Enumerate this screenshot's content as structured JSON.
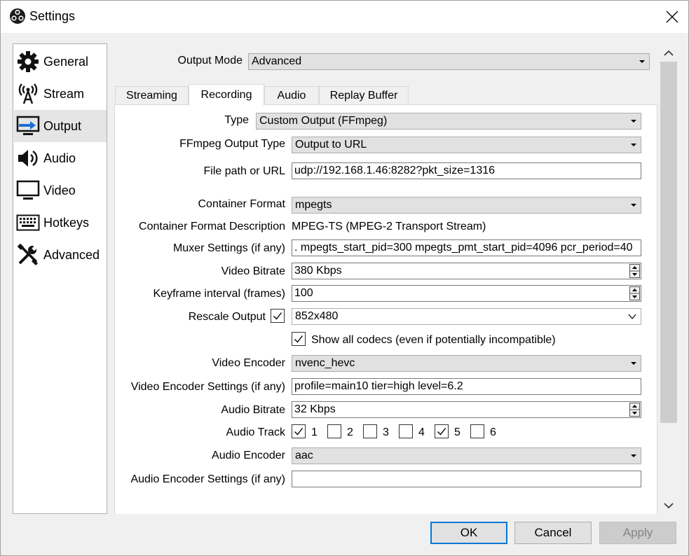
{
  "window": {
    "title": "Settings",
    "app_icon": "obs-logo-icon",
    "close_icon": "close-icon"
  },
  "sidebar": {
    "items": [
      {
        "label": "General",
        "icon": "gear-icon"
      },
      {
        "label": "Stream",
        "icon": "broadcast-tower-icon"
      },
      {
        "label": "Output",
        "icon": "monitor-output-icon",
        "selected": true
      },
      {
        "label": "Audio",
        "icon": "speaker-icon"
      },
      {
        "label": "Video",
        "icon": "monitor-icon"
      },
      {
        "label": "Hotkeys",
        "icon": "keyboard-icon"
      },
      {
        "label": "Advanced",
        "icon": "tools-icon"
      }
    ]
  },
  "output": {
    "mode_label": "Output Mode",
    "mode_value": "Advanced",
    "tabs": [
      {
        "label": "Streaming"
      },
      {
        "label": "Recording",
        "active": true
      },
      {
        "label": "Audio"
      },
      {
        "label": "Replay Buffer"
      }
    ]
  },
  "recording": {
    "type_label": "Type",
    "type_value": "Custom Output (FFmpeg)",
    "ffmpeg_type_label": "FFmpeg Output Type",
    "ffmpeg_type_value": "Output to URL",
    "url_label": "File path or URL",
    "url_value": "udp://192.168.1.46:8282?pkt_size=1316",
    "container_label": "Container Format",
    "container_value": "mpegts",
    "container_desc_label": "Container Format Description",
    "container_desc_value": "MPEG-TS (MPEG-2 Transport Stream)",
    "muxer_label": "Muxer Settings (if any)",
    "muxer_value": ". mpegts_start_pid=300 mpegts_pmt_start_pid=4096 pcr_period=40",
    "video_bitrate_label": "Video Bitrate",
    "video_bitrate_value": "380 Kbps",
    "keyframe_label": "Keyframe interval (frames)",
    "keyframe_value": "100",
    "rescale_label": "Rescale Output",
    "rescale_checked": true,
    "rescale_value": "852x480",
    "show_codecs_label": "Show all codecs (even if potentially incompatible)",
    "show_codecs_checked": true,
    "video_encoder_label": "Video Encoder",
    "video_encoder_value": "nvenc_hevc",
    "video_encoder_settings_label": "Video Encoder Settings (if any)",
    "video_encoder_settings_value": "profile=main10 tier=high level=6.2",
    "audio_bitrate_label": "Audio Bitrate",
    "audio_bitrate_value": "32 Kbps",
    "audio_track_label": "Audio Track",
    "audio_tracks": [
      {
        "label": "1",
        "checked": true
      },
      {
        "label": "2",
        "checked": false
      },
      {
        "label": "3",
        "checked": false
      },
      {
        "label": "4",
        "checked": false
      },
      {
        "label": "5",
        "checked": true
      },
      {
        "label": "6",
        "checked": false
      }
    ],
    "audio_encoder_label": "Audio Encoder",
    "audio_encoder_value": "aac",
    "audio_encoder_settings_label": "Audio Encoder Settings (if any)",
    "audio_encoder_settings_value": ""
  },
  "buttons": {
    "ok": "OK",
    "cancel": "Cancel",
    "apply": "Apply",
    "apply_disabled": true
  }
}
